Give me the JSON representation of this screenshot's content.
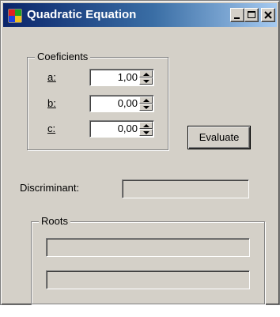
{
  "window": {
    "title": "Quadratic Equation"
  },
  "coefficients": {
    "legend": "Coeficients",
    "a": {
      "label": "a:",
      "value": "1,00"
    },
    "b": {
      "label": "b:",
      "value": "0,00"
    },
    "c": {
      "label": "c:",
      "value": "0,00"
    }
  },
  "evaluate": {
    "label": "Evaluate"
  },
  "discriminant": {
    "label": "Discriminant:",
    "value": ""
  },
  "roots": {
    "legend": "Roots",
    "root1": "",
    "root2": ""
  },
  "colors": {
    "face": "#d4d0c8",
    "title_start": "#0a246a",
    "title_end": "#a6caf0"
  }
}
